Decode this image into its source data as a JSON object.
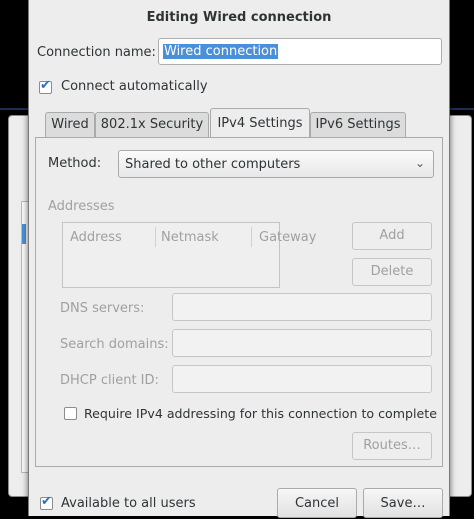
{
  "dialog": {
    "title": "Editing Wired connection",
    "connection_name_label": "Connection name:",
    "connection_name_value": "Wired connection",
    "connect_auto_label": "Connect automatically",
    "connect_auto_checked": true
  },
  "tabs": [
    {
      "label": "Wired",
      "active": false
    },
    {
      "label": "802.1x Security",
      "active": false
    },
    {
      "label": "IPv4 Settings",
      "active": true
    },
    {
      "label": "IPv6 Settings",
      "active": false
    }
  ],
  "ipv4": {
    "method_label": "Method:",
    "method_value": "Shared to other computers",
    "addresses_label": "Addresses",
    "columns": [
      "Address",
      "Netmask",
      "Gateway"
    ],
    "add_label": "Add",
    "delete_label": "Delete",
    "dns_label": "DNS servers:",
    "search_label": "Search domains:",
    "dhcp_label": "DHCP client ID:",
    "require_label": "Require IPv4 addressing for this connection to complete",
    "require_checked": false,
    "routes_label": "Routes…"
  },
  "footer": {
    "all_users_label": "Available to all users",
    "all_users_checked": true,
    "cancel_label": "Cancel",
    "save_label": "Save…"
  },
  "icons": {
    "check": "✔",
    "chevron": "⌄"
  }
}
